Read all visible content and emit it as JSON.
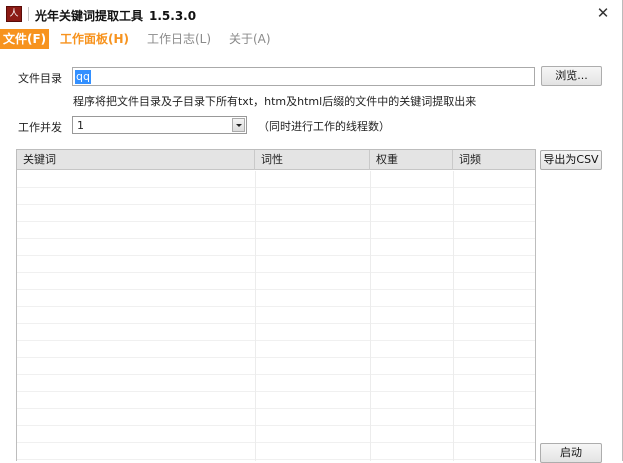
{
  "window": {
    "title": "光年关键词提取工具",
    "version": "1.5.3.0",
    "close_glyph": "✕"
  },
  "menu": [
    {
      "label": "文件(F)",
      "state": "active"
    },
    {
      "label": "工作面板(H)",
      "state": "highlight"
    },
    {
      "label": "工作日志(L)",
      "state": "normal"
    },
    {
      "label": "关于(A)",
      "state": "normal"
    }
  ],
  "form": {
    "dir_label": "文件目录",
    "dir_value": "qq",
    "browse_label": "浏览...",
    "hint": "程序将把文件目录及子目录下所有txt，htm及html后缀的文件中的关键词提取出来",
    "concurrency_label": "工作并发",
    "concurrency_value": "1",
    "concurrency_hint": "（同时进行工作的线程数）"
  },
  "table": {
    "columns": [
      "关键词",
      "词性",
      "权重",
      "词频"
    ]
  },
  "actions": {
    "export_label": "导出为CSV",
    "start_label": "启动"
  },
  "colors": {
    "accent_orange": "#f7931e",
    "selection_blue": "#3390ff"
  }
}
